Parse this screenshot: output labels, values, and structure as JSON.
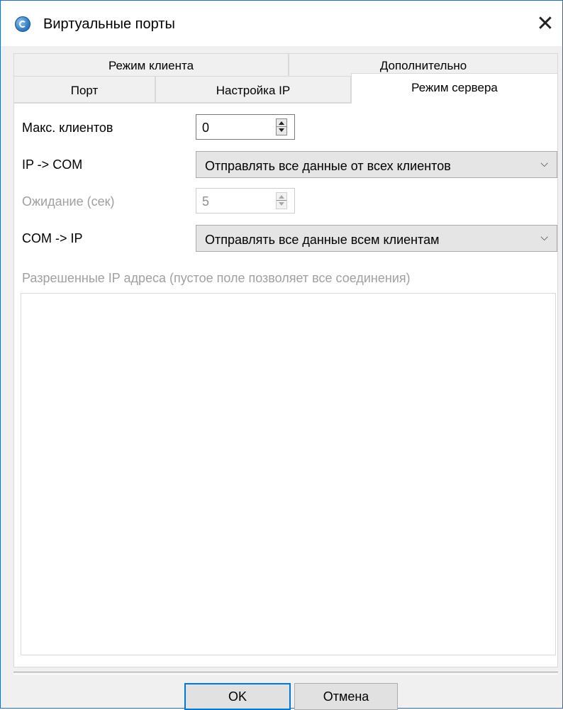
{
  "window": {
    "title": "Виртуальные порты",
    "close_symbol": "✕",
    "icon": "app-globe-icon"
  },
  "tabs": {
    "row_back": [
      {
        "label": "Режим клиента"
      },
      {
        "label": "Дополнительно"
      }
    ],
    "row_front": [
      {
        "label": "Порт"
      },
      {
        "label": "Настройка IP"
      },
      {
        "label": "Режим сервера",
        "active": true
      }
    ]
  },
  "server_mode": {
    "max_clients": {
      "label": "Макс. клиентов",
      "value": "0"
    },
    "ip_to_com": {
      "label": "IP -> COM",
      "selected": "Отправлять все данные от всех клиентов"
    },
    "timeout": {
      "label": "Ожидание (сек)",
      "value": "5",
      "disabled": true
    },
    "com_to_ip": {
      "label": "COM -> IP",
      "selected": "Отправлять все данные всем клиентам"
    },
    "allowed_ips": {
      "label": "Разрешенные IP адреса (пустое поле позволяет все соединения)",
      "items": []
    }
  },
  "buttons": {
    "ok": "OK",
    "cancel": "Отмена"
  },
  "icons": {
    "dropdown": "⌵"
  }
}
